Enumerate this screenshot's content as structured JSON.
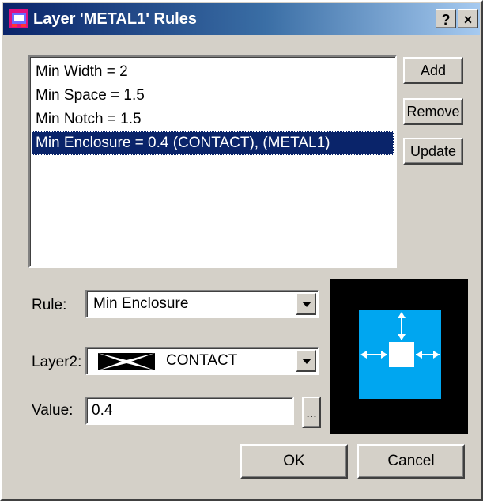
{
  "window": {
    "title": "Layer 'METAL1' Rules",
    "help_label": "?",
    "close_label": "×",
    "icon": "app-layer-icon"
  },
  "rules_list": {
    "items": [
      {
        "label": "Min Width = 2",
        "selected": false
      },
      {
        "label": "Min Space = 1.5",
        "selected": false
      },
      {
        "label": "Min Notch = 1.5",
        "selected": false
      },
      {
        "label": "Min Enclosure = 0.4 (CONTACT), (METAL1)",
        "selected": true
      }
    ]
  },
  "actions": {
    "add_label": "Add",
    "remove_label": "Remove",
    "update_label": "Update"
  },
  "form": {
    "rule_label": "Rule:",
    "rule_value": "Min Enclosure",
    "layer2_label": "Layer2:",
    "layer2_value": "CONTACT",
    "layer2_swatch": "black-cross-pattern",
    "value_label": "Value:",
    "value_value": "0.4",
    "ellipsis_label": "..."
  },
  "preview": {
    "background": "#000000",
    "outer_color": "#00a6f0",
    "inner_color": "#ffffff",
    "icon": "enclosure-diagram"
  },
  "footer": {
    "ok_label": "OK",
    "cancel_label": "Cancel"
  },
  "colors": {
    "titlebar_start": "#0a246a",
    "titlebar_end": "#a6caf0",
    "selection": "#0a246a",
    "dialog_bg": "#d4d0c8"
  }
}
